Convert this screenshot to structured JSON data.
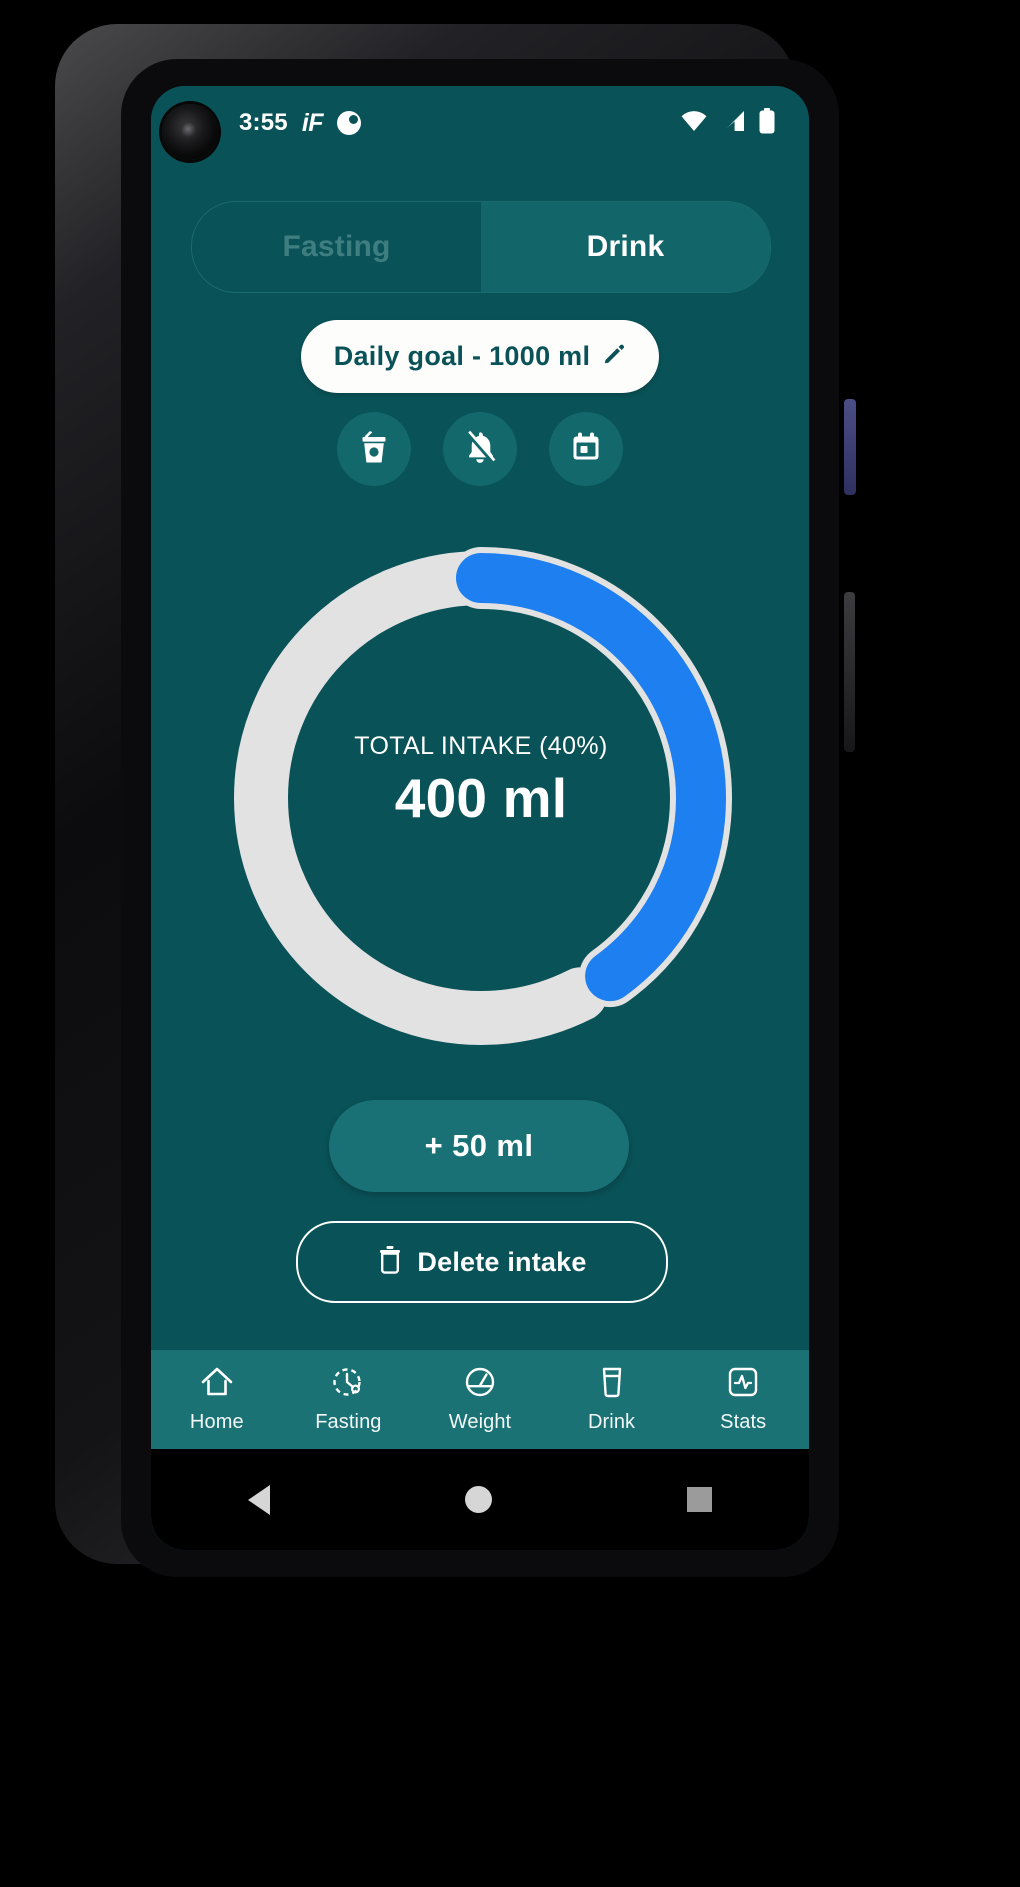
{
  "status_bar": {
    "time": "3:55",
    "app_label": "iF",
    "app_badge_icon": "app-notification-icon",
    "wifi_icon": "wifi-icon",
    "signal_icon": "cellular-signal-icon",
    "battery_icon": "battery-icon"
  },
  "tabs": {
    "items": [
      {
        "label": "Fasting",
        "active": false
      },
      {
        "label": "Drink",
        "active": true
      }
    ]
  },
  "goal": {
    "label": "Daily goal - 1000 ml",
    "edit_icon": "pencil-edit-icon"
  },
  "quick_actions": [
    {
      "name": "cup-with-straw-icon",
      "label": "drink-size"
    },
    {
      "name": "bell-off-icon",
      "label": "reminders-off"
    },
    {
      "name": "calendar-icon",
      "label": "history-calendar"
    }
  ],
  "progress": {
    "label": "TOTAL INTAKE (40%)",
    "value": "400 ml",
    "percent": 40,
    "goal_ml": 1000,
    "intake_ml": 400,
    "track_color": "#e2e2e2",
    "fill_color": "#1d7ff0",
    "background_color": "#095257"
  },
  "buttons": {
    "add_label": "+ 50 ml",
    "delete_label": "Delete intake",
    "delete_icon": "trash-icon"
  },
  "bottom_nav": {
    "items": [
      {
        "label": "Home",
        "icon": "home-icon"
      },
      {
        "label": "Fasting",
        "icon": "fasting-timer-icon"
      },
      {
        "label": "Weight",
        "icon": "weight-scale-icon"
      },
      {
        "label": "Drink",
        "icon": "glass-icon"
      },
      {
        "label": "Stats",
        "icon": "stats-pulse-icon"
      }
    ]
  },
  "system_nav": {
    "back": "back-triangle-icon",
    "home": "home-circle-icon",
    "recents": "recents-square-icon"
  },
  "colors": {
    "app_background": "#095257",
    "nav_background": "#1b7274",
    "accent_blue": "#1d7ff0",
    "pill_white": "#fdfdfb"
  }
}
